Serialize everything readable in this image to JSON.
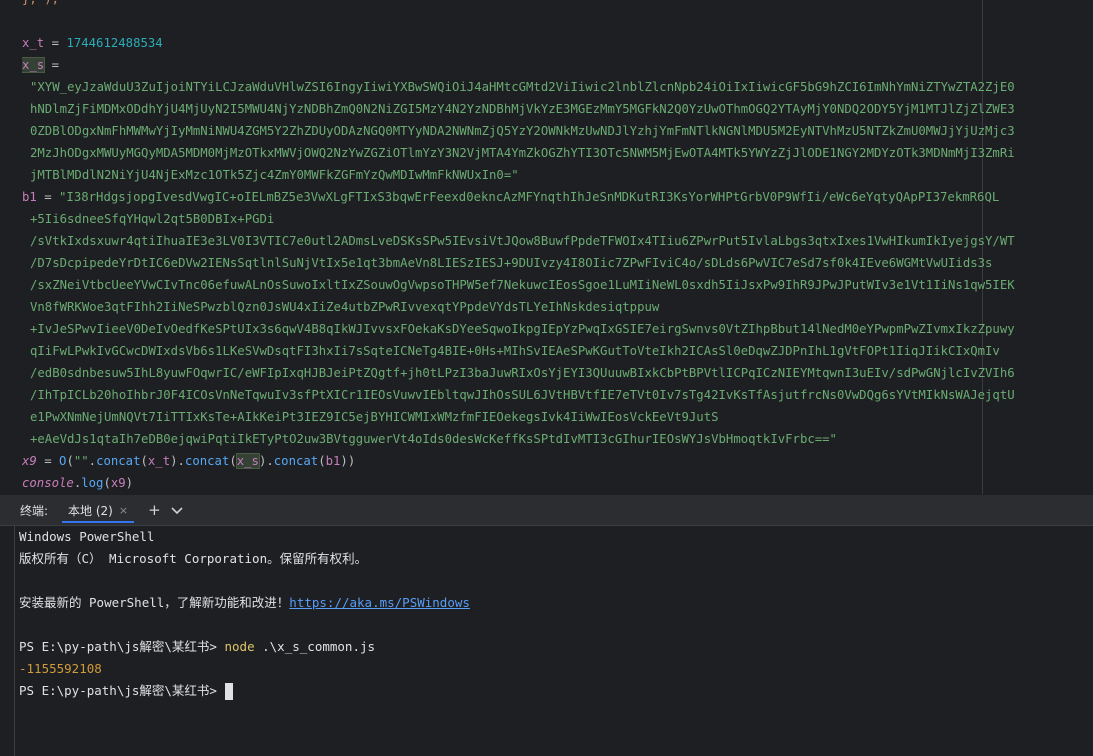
{
  "editor": {
    "line_top": "}, );",
    "line_xt_name": "x_t",
    "line_xt_eq": " = ",
    "line_xt_value": "1744612488534",
    "line_xs_name": "x_s",
    "line_xs_eq": " =",
    "xs_lines": [
      "\"XYW_eyJzaWduU3ZuIjoiNTYiLCJzaWduVHlwZSI6IngyIiwiYXBwSWQiOiJ4aHMtcGMtd2ViIiwic2lnblZlcnNpb24iOiIxIiwicGF5bG9hZCI6ImNhYmNiZTYwZTA2ZjE0",
      "hNDlmZjFiMDMxODdhYjU4MjUyN2I5MWU4NjYzNDBhZmQ0N2NiZGI5MzY4N2YzNDBhMjVkYzE3MGEzMmY5MGFkN2Q0YzUwOThmOGQ2YTAyMjY0NDQ2ODY5YjM1MTJlZjZlZWE3",
      "0ZDBlODgxNmFhMWMwYjIyMmNiNWU4ZGM5Y2ZhZDUyODAzNGQ0MTYyNDA2NWNmZjQ5YzY2OWNkMzUwNDJlYzhjYmFmNTlkNGNlMDU5M2EyNTVhMzU5NTZkZmU0MWJjYjUzMjc3",
      "2MzJhODgxMWUyMGQyMDA5MDM0MjMzOTkxMWVjOWQ2NzYwZGZiOTlmYzY3N2VjMTA4YmZkOGZhYTI3OTc5NWM5MjEwOTA4MTk5YWYzZjJlODE1NGY2MDYzOTk3MDNmMjI3ZmRi",
      "jMTBlMDdlN2NiYjU4NjExMzc1OTk5Zjc4ZmY0MWFkZGFmYzQwMDIwMmFkNWUxIn0=\""
    ],
    "line_b1_name": "b1",
    "line_b1_eq": " = ",
    "b1_lines": [
      "\"I38rHdgsjopgIvesdVwgIC+oIELmBZ5e3VwXLgFTIxS3bqwErFeexd0ekncAzMFYnqthIhJeSnMDKutRI3KsYorWHPtGrbV0P9WfIi/eWc6eYqtyQApPI37ekmR6QL",
      "+5Ii6sdneeSfqYHqwl2qt5B0DBIx+PGDi",
      "/sVtkIxdsxuwr4qtiIhuaIE3e3LV0I3VTIC7e0utl2ADmsLveDSKsSPw5IEvsiVtJQow8BuwfPpdeTFWOIx4TIiu6ZPwrPut5IvlaLbgs3qtxIxes1VwHIkumIkIyejgsY/WT",
      "/D7sDcpipedeYrDtIC6eDVw2IENsSqtlnlSuNjVtIx5e1qt3bmAeVn8LIESzIESJ+9DUIvzy4I8OIic7ZPwFIviC4o/sDLds6PwVIC7eSd7sf0k4IEve6WGMtVwUIids3s",
      "/sxZNeiVtbcUeeYVwCIvTnc06efuwALnOsSuwoIxltIxZSouwOgVwpsoTHPW5ef7NekuwcIEosSgoe1LuMIiNeWL0sxdh5IiJsxPw9IhR9JPwJPutWIv3e1Vt1IiNs1qw5IEK",
      "Vn8fWRKWoe3qtFIhh2IiNeSPwzblQzn0JsWU4xIiZe4utbZPwRIvvexqtYPpdeVYdsTLYeIhNskdesiqtppuw",
      "+IvJeSPwvIieeV0DeIvOedfKeSPtUIx3s6qwV4B8qIkWJIvvsxFOekaKsDYeeSqwoIkpgIEpYzPwqIxGSIE7eirgSwnvs0VtZIhpBbut14lNedM0eYPwpmPwZIvmxIkzZpuwy",
      "qIiFwLPwkIvGCwcDWIxdsVb6s1LKeSVwDsqtFI3hxIi7sSqteICNeTg4BIE+0Hs+MIhSvIEAeSPwKGutToVteIkh2ICAsSl0eDqwZJDPnIhL1gVtFOPt1IiqJIikCIxQmIv",
      "/edB0sdnbesuw5IhL8yuwFOqwrIC/eWFIpIxqHJBJeiPtZQgtf+jh0tLPzI3baJuwRIxOsYjEYI3QUuuwBIxkCbPtBPVtlICPqICzNIEYMtqwnI3uEIv/sdPwGNjlcIvZVIh6",
      "/IhTpICLb20hoIhbrJ0F4ICOsVnNeTqwuIv3sfPtXICr1IEOsVuwvIEbltqwJIhOsSUL6JVtHBVtfIE7eTVt0Iv7sTg42IvKsTfAsjutfrcNs0VwDQg6sYVtMIkNsWAJejqtU",
      "e1PwXNmNejUmNQVt7IiTTIxKsTe+AIkKeiPt3IEZ9IC5ejBYHICWMIxWMzfmFIEOekegsIvk4IiWwIEosVckEeVt9JutS",
      "+eAeVdJs1qtaIh7eDB0ejqwiPqtiIkETyPtO2uw3BVtgguwerVt4oIds0desWcKeffKsSPtdIvMTI3cGIhurIEOsWYJsVbHmoqtkIvFrbc==\""
    ],
    "line_x9_name": "x9",
    "line_x9_rest_a": " = ",
    "line_x9_fn": "O",
    "line_x9_open": "(",
    "line_x9_str": "\"\"",
    "line_x9_dot1": ".",
    "line_x9_concat1": "concat",
    "line_x9_p1": "(",
    "line_x9_arg1": "x_t",
    "line_x9_p1c": ").",
    "line_x9_concat2": "concat",
    "line_x9_p2": "(",
    "line_x9_arg2": "x_s",
    "line_x9_p2c": ").",
    "line_x9_concat3": "concat",
    "line_x9_p3": "(",
    "line_x9_arg3": "b1",
    "line_x9_end": "))",
    "line_console": "console",
    "line_console_dot": ".",
    "line_console_log": "log",
    "line_console_p": "(",
    "line_console_arg": "x9",
    "line_console_end": ")"
  },
  "terminal": {
    "title": "终端:",
    "tab_label": "本地 (2)",
    "close_glyph": "×",
    "add_glyph": "+",
    "dropdown_glyph": "⌄",
    "lines": {
      "l1": "Windows PowerShell",
      "l2": "版权所有（C） Microsoft Corporation。保留所有权利。",
      "l3": "",
      "l4_text": "安装最新的 PowerShell，了解新功能和改进！",
      "l4_link": "https://aka.ms/PSWindows",
      "l5": "",
      "l6_prompt": "PS E:\\py-path\\js解密\\某红书> ",
      "l6_cmd": "node",
      "l6_arg": " .\\x_s_common.js",
      "l7_output": "-1155592108",
      "l8_prompt": "PS E:\\py-path\\js解密\\某红书> "
    }
  }
}
